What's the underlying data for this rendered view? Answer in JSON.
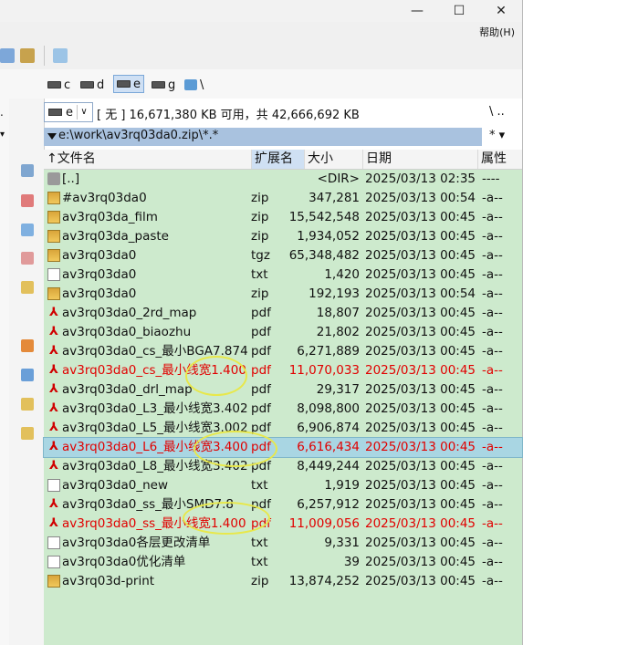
{
  "window": {
    "minimize_glyph": "—",
    "maximize_glyph": "☐",
    "close_glyph": "✕"
  },
  "menu": {
    "help_label": "帮助(H)"
  },
  "drives": [
    {
      "letter": "c",
      "selected": false
    },
    {
      "letter": "d",
      "selected": false
    },
    {
      "letter": "e",
      "selected": true
    },
    {
      "letter": "g",
      "selected": false
    }
  ],
  "drive_extra": "\\",
  "left_panel_markers": {
    "dot": ".",
    "arrow": "▾"
  },
  "infobar": {
    "drive": "e",
    "combo_arrow": "∨",
    "free_text": "[ 无 ]  16,671,380 KB 可用，共 42,666,692 KB",
    "right_symbols": "\\   .."
  },
  "path": {
    "text": "e:\\work\\av3rq03da0.zip\\*.*",
    "right_symbols": "*  ▾"
  },
  "columns": {
    "name": "↑文件名",
    "ext": "扩展名",
    "size": "大小",
    "date": "日期",
    "attr": "属性"
  },
  "files": [
    {
      "name": "[..]",
      "ext": "",
      "size": "<DIR>",
      "date": "2025/03/13 02:35",
      "attr": "----",
      "icon": "folder-up",
      "red": false,
      "current": false
    },
    {
      "name": "#av3rq03da0",
      "ext": "zip",
      "size": "347,281",
      "date": "2025/03/13 00:54",
      "attr": "-a--",
      "icon": "zip",
      "red": false,
      "current": false
    },
    {
      "name": "av3rq03da_film",
      "ext": "zip",
      "size": "15,542,548",
      "date": "2025/03/13 00:45",
      "attr": "-a--",
      "icon": "zip",
      "red": false,
      "current": false
    },
    {
      "name": "av3rq03da_paste",
      "ext": "zip",
      "size": "1,934,052",
      "date": "2025/03/13 00:45",
      "attr": "-a--",
      "icon": "zip",
      "red": false,
      "current": false
    },
    {
      "name": "av3rq03da0",
      "ext": "tgz",
      "size": "65,348,482",
      "date": "2025/03/13 00:45",
      "attr": "-a--",
      "icon": "zip",
      "red": false,
      "current": false
    },
    {
      "name": "av3rq03da0",
      "ext": "txt",
      "size": "1,420",
      "date": "2025/03/13 00:45",
      "attr": "-a--",
      "icon": "txt",
      "red": false,
      "current": false
    },
    {
      "name": "av3rq03da0",
      "ext": "zip",
      "size": "192,193",
      "date": "2025/03/13 00:54",
      "attr": "-a--",
      "icon": "zip",
      "red": false,
      "current": false
    },
    {
      "name": "av3rq03da0_2rd_map",
      "ext": "pdf",
      "size": "18,807",
      "date": "2025/03/13 00:45",
      "attr": "-a--",
      "icon": "pdf",
      "red": false,
      "current": false
    },
    {
      "name": "av3rq03da0_biaozhu",
      "ext": "pdf",
      "size": "21,802",
      "date": "2025/03/13 00:45",
      "attr": "-a--",
      "icon": "pdf",
      "red": false,
      "current": false
    },
    {
      "name": "av3rq03da0_cs_最小BGA7.874",
      "ext": "pdf",
      "size": "6,271,889",
      "date": "2025/03/13 00:45",
      "attr": "-a--",
      "icon": "pdf",
      "red": false,
      "current": false
    },
    {
      "name": "av3rq03da0_cs_最小线宽1.400",
      "ext": "pdf",
      "size": "11,070,033",
      "date": "2025/03/13 00:45",
      "attr": "-a--",
      "icon": "pdf",
      "red": true,
      "current": false
    },
    {
      "name": "av3rq03da0_drl_map",
      "ext": "pdf",
      "size": "29,317",
      "date": "2025/03/13 00:45",
      "attr": "-a--",
      "icon": "pdf",
      "red": false,
      "current": false
    },
    {
      "name": "av3rq03da0_L3_最小线宽3.402",
      "ext": "pdf",
      "size": "8,098,800",
      "date": "2025/03/13 00:45",
      "attr": "-a--",
      "icon": "pdf",
      "red": false,
      "current": false
    },
    {
      "name": "av3rq03da0_L5_最小线宽3.002",
      "ext": "pdf",
      "size": "6,906,874",
      "date": "2025/03/13 00:45",
      "attr": "-a--",
      "icon": "pdf",
      "red": false,
      "current": false
    },
    {
      "name": "av3rq03da0_L6_最小线宽3.400",
      "ext": "pdf",
      "size": "6,616,434",
      "date": "2025/03/13 00:45",
      "attr": "-a--",
      "icon": "pdf",
      "red": true,
      "current": true
    },
    {
      "name": "av3rq03da0_L8_最小线宽3.402",
      "ext": "pdf",
      "size": "8,449,244",
      "date": "2025/03/13 00:45",
      "attr": "-a--",
      "icon": "pdf",
      "red": false,
      "current": false
    },
    {
      "name": "av3rq03da0_new",
      "ext": "txt",
      "size": "1,919",
      "date": "2025/03/13 00:45",
      "attr": "-a--",
      "icon": "txt",
      "red": false,
      "current": false
    },
    {
      "name": "av3rq03da0_ss_最小SMD7.8",
      "ext": "pdf",
      "size": "6,257,912",
      "date": "2025/03/13 00:45",
      "attr": "-a--",
      "icon": "pdf",
      "red": false,
      "current": false
    },
    {
      "name": "av3rq03da0_ss_最小线宽1.400",
      "ext": "pdf",
      "size": "11,009,056",
      "date": "2025/03/13 00:45",
      "attr": "-a--",
      "icon": "pdf",
      "red": true,
      "current": false
    },
    {
      "name": "av3rq03da0各层更改清单",
      "ext": "txt",
      "size": "9,331",
      "date": "2025/03/13 00:45",
      "attr": "-a--",
      "icon": "txt",
      "red": false,
      "current": false
    },
    {
      "name": "av3rq03da0优化清单",
      "ext": "txt",
      "size": "39",
      "date": "2025/03/13 00:45",
      "attr": "-a--",
      "icon": "txt",
      "red": false,
      "current": false
    },
    {
      "name": "av3rq03d-print",
      "ext": "zip",
      "size": "13,874,252",
      "date": "2025/03/13 00:45",
      "attr": "-a--",
      "icon": "zip",
      "red": false,
      "current": false
    }
  ],
  "colors": {
    "list_bg": "#cdeacd",
    "highlight_red": "#e10000",
    "cursor_row": "#a9d6e3",
    "annotation_circle": "#e8e84a"
  }
}
